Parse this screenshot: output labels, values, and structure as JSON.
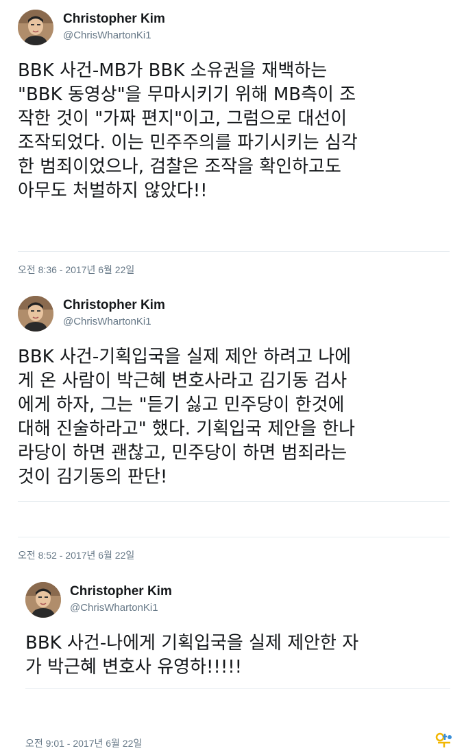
{
  "tweets": [
    {
      "author_name": "Christopher Kim",
      "handle": "@ChrisWhartonKi1",
      "text": "BBK 사건-MB가 BBK 소유권을 재백하는\n\"BBK 동영상\"을 무마시키기 위해 MB측이 조\n작한 것이 \"가짜 편지\"이고, 그럼으로 대선이\n조작되었다. 이는 민주주의를 파기시키는 심각\n한 범죄이었으나, 검찰은 조작을 확인하고도\n아무도 처벌하지 않았다!!",
      "timestamp": "오전 8:36 - 2017년 6월 22일"
    },
    {
      "author_name": "Christopher Kim",
      "handle": "@ChrisWhartonKi1",
      "text": "BBK 사건-기획입국을 실제 제안 하려고 나에\n게 온 사람이 박근혜 변호사라고 김기동 검사\n에게 하자, 그는 \"듣기 싫고 민주당이 한것에\n대해 진술하라고\" 했다. 기획입국 제안을 한나\n라당이 하면 괜찮고, 민주당이 하면 범죄라는\n것이 김기동의 판단!",
      "timestamp": "오전 8:52 - 2017년 6월 22일"
    },
    {
      "author_name": "Christopher Kim",
      "handle": "@ChrisWhartonKi1",
      "text": "BBK 사건-나에게 기획입국을 실제 제안한 자\n가 박근혜 변호사 유영하!!!!!",
      "timestamp": "오전 9:01 - 2017년 6월 22일"
    }
  ],
  "watermark_icon": "yellow-logo-icon"
}
